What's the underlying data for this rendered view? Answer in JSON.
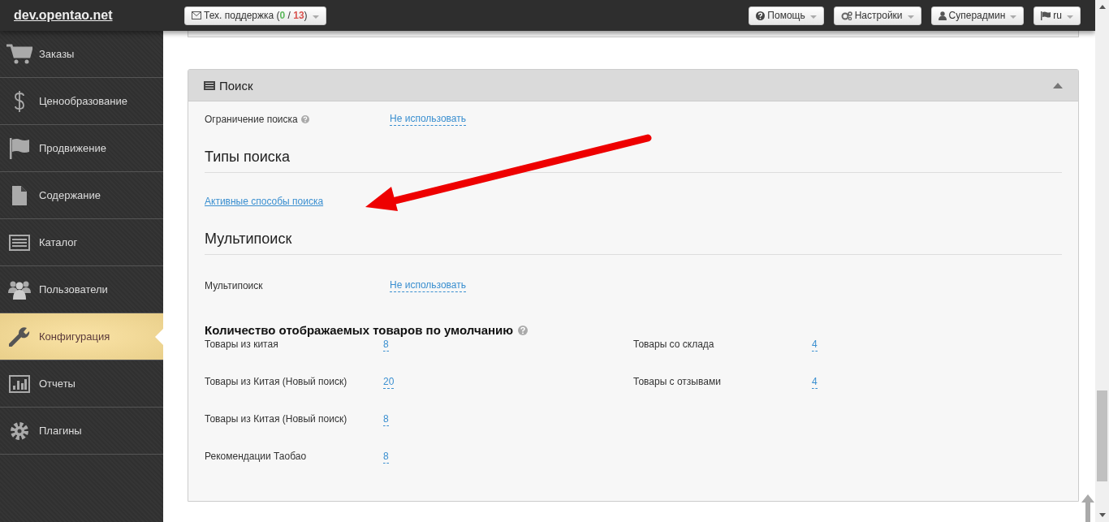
{
  "site": {
    "title": "dev.opentao.net"
  },
  "support_button": {
    "parts": [
      {
        "text": "Тех. поддержка ("
      },
      {
        "text": "0",
        "color": "#5cb85c"
      },
      {
        "text": " / "
      },
      {
        "text": "13",
        "color": "#d9534f"
      },
      {
        "text": ")"
      }
    ]
  },
  "top_menus": [
    {
      "label": "Помощь"
    },
    {
      "label": "Настройки"
    },
    {
      "label": "Суперадмин"
    },
    {
      "label": "ru"
    }
  ],
  "sidebar": {
    "items": [
      {
        "label": "Заказы",
        "selected": false
      },
      {
        "label": "Ценообразование",
        "selected": false
      },
      {
        "label": "Продвижение",
        "selected": false
      },
      {
        "label": "Содержание",
        "selected": false
      },
      {
        "label": "Каталог",
        "selected": false
      },
      {
        "label": "Пользователи",
        "selected": false
      },
      {
        "label": "Конфигурация",
        "selected": true
      },
      {
        "label": "Отчеты",
        "selected": false
      },
      {
        "label": "Плагины",
        "selected": false
      }
    ]
  },
  "panel": {
    "title": "Поиск",
    "expanded": true,
    "search_limit": {
      "label": "Ограничение поиска",
      "help": true,
      "value": "Не использовать"
    },
    "search_types": {
      "heading": "Типы поиска",
      "link": "Активные способы поиска"
    },
    "multisearch": {
      "heading": "Мультипоиск",
      "label": "Мультипоиск",
      "value": "Не использовать"
    },
    "counts": {
      "heading": "Количество отображаемых товаров по умолчанию",
      "help": true,
      "left": [
        {
          "label": "Товары из китая",
          "value": "8"
        },
        {
          "label": "Товары из Китая (Новый поиск)",
          "value": "20"
        },
        {
          "label": "Товары из Китая (Новый поиск)",
          "value": "8"
        },
        {
          "label": "Рекомендации Таобао",
          "value": "8"
        }
      ],
      "right": [
        {
          "label": "Товары со склада",
          "value": "4"
        },
        {
          "label": "Товары с отзывами",
          "value": "4"
        }
      ]
    }
  }
}
